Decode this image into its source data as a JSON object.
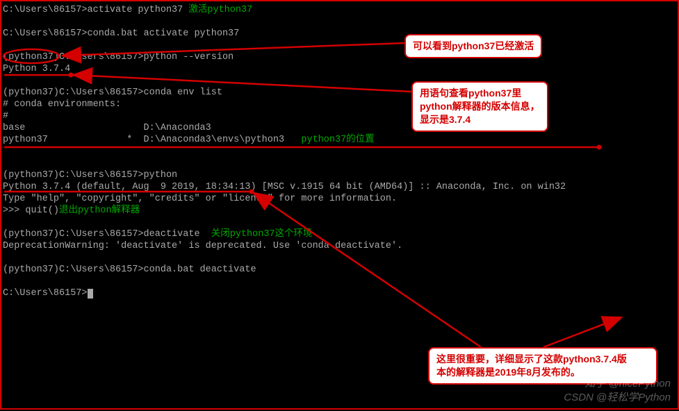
{
  "terminal": {
    "l1a": "C:\\Users\\86157>activate python37 ",
    "l1b": "激活python37",
    "l2": "",
    "l3": "C:\\Users\\86157>conda.bat activate python37",
    "l4": "",
    "l5a": "(python37)",
    "l5b": "C:\\Users\\86157>python --version",
    "l6": "Python 3.7.4",
    "l7": "",
    "l8": "(python37)C:\\Users\\86157>conda env list",
    "l9": "# conda environments:",
    "l10": "#",
    "l11": "base                     D:\\Anaconda3",
    "l12a": "python37              *  D:\\Anaconda3\\envs\\python3   ",
    "l12b": "python37的位置",
    "l13": "",
    "l14": "",
    "l15": "(python37)C:\\Users\\86157>python",
    "l16": "Python 3.7.4 (default, Aug  9 2019, 18:34:13) [MSC v.1915 64 bit (AMD64)] :: Anaconda, Inc. on win32",
    "l17": "Type \"help\", \"copyright\", \"credits\" or \"license\" for more information.",
    "l18a": ">>> quit()",
    "l18b": "退出python解释器",
    "l19": "",
    "l20a": "(python37)C:\\Users\\86157>deactivate  ",
    "l20b": "关闭python37这个环境",
    "l21": "DeprecationWarning: 'deactivate' is deprecated. Use 'conda deactivate'.",
    "l22": "",
    "l23": "(python37)C:\\Users\\86157>conda.bat deactivate",
    "l24": "",
    "l25": "C:\\Users\\86157>"
  },
  "callouts": {
    "c1": "可以看到python37已经激活",
    "c2a": "用语句查看python37里",
    "c2b": "python解释器的版本信息，",
    "c2c": "显示是3.7.4",
    "c3a": "这里很重要，详细显示了这款python3.7.4版",
    "c3b": "本的解释器是2019年8月发布的。"
  },
  "watermark": {
    "l1": "知乎 @nicePython",
    "l2": "CSDN @轻松学Python"
  }
}
